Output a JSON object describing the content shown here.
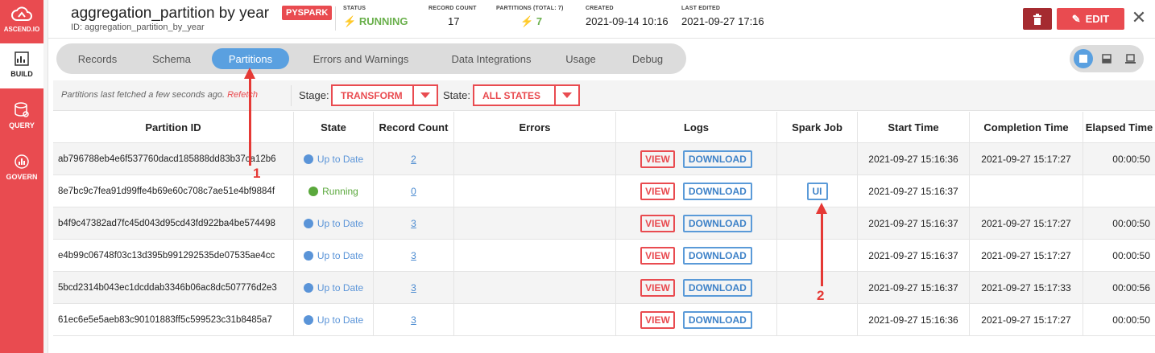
{
  "rail": {
    "logo_label": "ASCEND.IO",
    "items": [
      {
        "label": "BUILD",
        "icon": "build-icon",
        "active": true
      },
      {
        "label": "QUERY",
        "icon": "query-icon",
        "active": false
      },
      {
        "label": "GOVERN",
        "icon": "govern-icon",
        "active": false
      }
    ]
  },
  "header": {
    "title": "aggregation_partition by year",
    "id_text": "ID: aggregation_partition_by_year",
    "badge": "PYSPARK",
    "status_key": "STATUS",
    "status_value": "RUNNING",
    "record_count_key": "RECORD COUNT",
    "record_count_value": "17",
    "partitions_key": "PARTITIONS (TOTAL: 7)",
    "partitions_value": "7",
    "created_key": "CREATED",
    "created_value": "2021-09-14 10:16",
    "edited_key": "LAST EDITED",
    "edited_value": "2021-09-27 17:16",
    "edit_label": "EDIT",
    "close_glyph": "✕"
  },
  "tabs": [
    "Records",
    "Schema",
    "Partitions",
    "Errors and Warnings",
    "Data Integrations",
    "Usage",
    "Debug"
  ],
  "active_tab": "Partitions",
  "filter": {
    "note": "Partitions last fetched a few seconds ago.",
    "refetch": "Refetch",
    "stage_label": "Stage:",
    "stage_value": "TRANSFORM",
    "state_label": "State:",
    "state_value": "ALL STATES"
  },
  "table": {
    "columns": [
      "Partition ID",
      "State",
      "Record Count",
      "Errors",
      "Logs",
      "Spark Job",
      "Start Time",
      "Completion Time",
      "Elapsed Time"
    ],
    "view_label": "VIEW",
    "download_label": "DOWNLOAD",
    "ui_label": "UI",
    "rows": [
      {
        "id": "ab796788eb4e6f537760dacd185888dd83b37ca12b6",
        "state": "Up to Date",
        "count": "2",
        "ui": "",
        "start": "2021-09-27 15:16:36",
        "end": "2021-09-27 15:17:27",
        "elapsed": "00:00:50"
      },
      {
        "id": "8e7bc9c7fea91d99ffe4b69e60c708c7ae51e4bf9884f",
        "state": "Running",
        "count": "0",
        "ui": "UI",
        "start": "2021-09-27 15:16:37",
        "end": "",
        "elapsed": ""
      },
      {
        "id": "b4f9c47382ad7fc45d043d95cd43fd922ba4be574498",
        "state": "Up to Date",
        "count": "3",
        "ui": "",
        "start": "2021-09-27 15:16:37",
        "end": "2021-09-27 15:17:27",
        "elapsed": "00:00:50"
      },
      {
        "id": "e4b99c06748f03c13d395b991292535de07535ae4cc",
        "state": "Up to Date",
        "count": "3",
        "ui": "",
        "start": "2021-09-27 15:16:37",
        "end": "2021-09-27 15:17:27",
        "elapsed": "00:00:50"
      },
      {
        "id": "5bcd2314b043ec1dcddab3346b06ac8dc507776d2e3",
        "state": "Up to Date",
        "count": "3",
        "ui": "",
        "start": "2021-09-27 15:16:37",
        "end": "2021-09-27 15:17:33",
        "elapsed": "00:00:56"
      },
      {
        "id": "61ec6e5e5aeb83c90101883ff5c599523c31b8485a7",
        "state": "Up to Date",
        "count": "3",
        "ui": "",
        "start": "2021-09-27 15:16:36",
        "end": "2021-09-27 15:17:27",
        "elapsed": "00:00:50"
      }
    ]
  },
  "annotations": [
    "1",
    "2"
  ],
  "colors": {
    "brand_red": "#e94b50",
    "accent_blue": "#5aa0e0",
    "running_green": "#6ab04c"
  }
}
